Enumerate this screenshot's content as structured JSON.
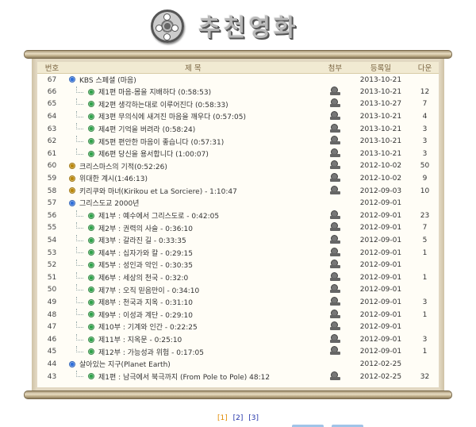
{
  "header": {
    "title": "추천영화"
  },
  "table": {
    "columns": [
      "번호",
      "제 목",
      "첨부",
      "등록일",
      "다운"
    ],
    "rows": [
      {
        "num": "67",
        "level": 0,
        "icon": "blue",
        "title": "KBS 스페셜 (마음)",
        "attach": false,
        "date": "2013-10-21",
        "downloads": ""
      },
      {
        "num": "66",
        "level": 1,
        "icon": "green",
        "title": "제1편 마음-몸을 지배하다 (0:58:53)",
        "attach": true,
        "date": "2013-10-21",
        "downloads": "12"
      },
      {
        "num": "65",
        "level": 1,
        "icon": "green",
        "title": "제2편 생각하는대로 이루어진다 (0:58:33)",
        "attach": true,
        "date": "2013-10-27",
        "downloads": "7"
      },
      {
        "num": "64",
        "level": 1,
        "icon": "green",
        "title": "제3편 무의식에 새겨진 마음을 깨우다 (0:57:05)",
        "attach": true,
        "date": "2013-10-21",
        "downloads": "4"
      },
      {
        "num": "63",
        "level": 1,
        "icon": "green",
        "title": "제4편 기억을 버려라 (0:58:24)",
        "attach": true,
        "date": "2013-10-21",
        "downloads": "3"
      },
      {
        "num": "62",
        "level": 1,
        "icon": "green",
        "title": "제5편 편안한 마음이 좋습니다 (0:57:31)",
        "attach": true,
        "date": "2013-10-21",
        "downloads": "3"
      },
      {
        "num": "61",
        "level": 1,
        "icon": "green",
        "title": "제6편 당신을 용서합니다 (1:00:07)",
        "attach": true,
        "date": "2013-10-21",
        "downloads": "3"
      },
      {
        "num": "60",
        "level": 0,
        "icon": "gold",
        "title": "크리스마스의 기적(0:52:26)",
        "attach": true,
        "date": "2012-10-02",
        "downloads": "50"
      },
      {
        "num": "59",
        "level": 0,
        "icon": "gold",
        "title": "위대한 계시(1:46:13)",
        "attach": true,
        "date": "2012-10-02",
        "downloads": "9"
      },
      {
        "num": "58",
        "level": 0,
        "icon": "gold",
        "title": "키리쿠와 마녀(Kirikou et La Sorciere) - 1:10:47",
        "attach": true,
        "date": "2012-09-03",
        "downloads": "10"
      },
      {
        "num": "57",
        "level": 0,
        "icon": "blue",
        "title": "그리스도교 2000년",
        "attach": false,
        "date": "2012-09-01",
        "downloads": ""
      },
      {
        "num": "56",
        "level": 1,
        "icon": "green",
        "title": "제1부 : 예수에서 그리스도로 - 0:42:05",
        "attach": true,
        "date": "2012-09-01",
        "downloads": "23"
      },
      {
        "num": "55",
        "level": 1,
        "icon": "green",
        "title": "제2부 : 권력의 사슬 - 0:36:10",
        "attach": true,
        "date": "2012-09-01",
        "downloads": "7"
      },
      {
        "num": "54",
        "level": 1,
        "icon": "green",
        "title": "제3부 : 갈라진 길 - 0:33:35",
        "attach": true,
        "date": "2012-09-01",
        "downloads": "5"
      },
      {
        "num": "53",
        "level": 1,
        "icon": "green",
        "title": "제4부 : 십자가와 칼 - 0:29:15",
        "attach": true,
        "date": "2012-09-01",
        "downloads": "1"
      },
      {
        "num": "52",
        "level": 1,
        "icon": "green",
        "title": "제5부 : 성인과 악인 - 0:30:35",
        "attach": true,
        "date": "2012-09-01",
        "downloads": ""
      },
      {
        "num": "51",
        "level": 1,
        "icon": "green",
        "title": "제6부 : 세상의 천국 - 0:32:0",
        "attach": true,
        "date": "2012-09-01",
        "downloads": "1"
      },
      {
        "num": "50",
        "level": 1,
        "icon": "green",
        "title": "제7부 : 오직 믿음만이 - 0:34:10",
        "attach": true,
        "date": "2012-09-01",
        "downloads": ""
      },
      {
        "num": "49",
        "level": 1,
        "icon": "green",
        "title": "제8부 : 천국과 지옥 - 0:31:10",
        "attach": true,
        "date": "2012-09-01",
        "downloads": "3"
      },
      {
        "num": "48",
        "level": 1,
        "icon": "green",
        "title": "제9부 : 이성과 계단 - 0:29:10",
        "attach": true,
        "date": "2012-09-01",
        "downloads": "1"
      },
      {
        "num": "47",
        "level": 1,
        "icon": "green",
        "title": "제10부 : 기계와 인간 - 0:22:25",
        "attach": true,
        "date": "2012-09-01",
        "downloads": ""
      },
      {
        "num": "46",
        "level": 1,
        "icon": "green",
        "title": "제11부 : 지옥문 - 0:25:10",
        "attach": true,
        "date": "2012-09-01",
        "downloads": "3"
      },
      {
        "num": "45",
        "level": 1,
        "icon": "green",
        "title": "제12부 : 가능성과 위험 - 0:17:05",
        "attach": true,
        "date": "2012-09-01",
        "downloads": "1"
      },
      {
        "num": "44",
        "level": 0,
        "icon": "blue",
        "title": "살아있는 지구(Planet Earth)",
        "attach": false,
        "date": "2012-02-25",
        "downloads": ""
      },
      {
        "num": "43",
        "level": 1,
        "icon": "green",
        "title": "제1편 : 남극에서 북극까지 (From Pole to Pole) 48:12",
        "attach": true,
        "date": "2012-02-25",
        "downloads": "32"
      }
    ]
  },
  "pager": {
    "current": "[1]",
    "pages": [
      "[2]",
      "[3]"
    ]
  },
  "colors": {
    "header_bg": "#f1ead2",
    "header_text": "#7a6440",
    "panel": "#e2d8c2",
    "link": "#2233aa",
    "current_page": "#e08a00"
  }
}
